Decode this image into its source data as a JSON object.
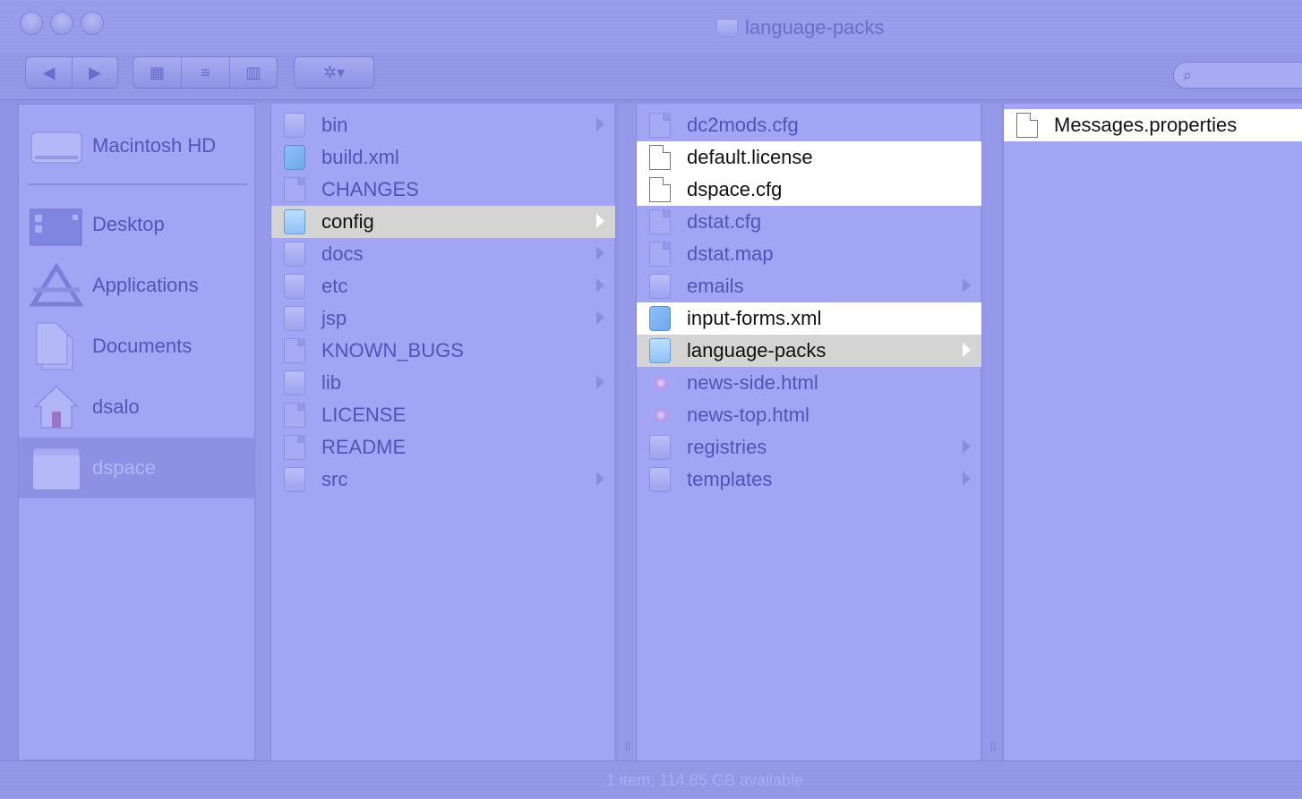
{
  "window": {
    "title": "language-packs"
  },
  "toolbar": {
    "back_icon": "◀",
    "forward_icon": "▶",
    "view_icon_grid": "▦",
    "view_icon_list": "≡",
    "view_icon_columns": "▥",
    "action_icon": "✲▾",
    "search_icon": "⌕"
  },
  "sidebar": {
    "items": [
      {
        "label": "Macintosh HD",
        "icon": "hard-drive-icon"
      },
      {
        "label": "Desktop",
        "icon": "desktop-icon"
      },
      {
        "label": "Applications",
        "icon": "applications-icon"
      },
      {
        "label": "Documents",
        "icon": "documents-icon"
      },
      {
        "label": "dsalo",
        "icon": "home-icon"
      },
      {
        "label": "dspace",
        "icon": "folder-icon"
      }
    ]
  },
  "columns": {
    "col1": [
      {
        "label": "bin",
        "kind": "folder"
      },
      {
        "label": "build.xml",
        "kind": "xml"
      },
      {
        "label": "CHANGES",
        "kind": "doc"
      },
      {
        "label": "config",
        "kind": "folder"
      },
      {
        "label": "docs",
        "kind": "folder"
      },
      {
        "label": "etc",
        "kind": "folder"
      },
      {
        "label": "jsp",
        "kind": "folder"
      },
      {
        "label": "KNOWN_BUGS",
        "kind": "doc"
      },
      {
        "label": "lib",
        "kind": "folder"
      },
      {
        "label": "LICENSE",
        "kind": "doc"
      },
      {
        "label": "README",
        "kind": "doc"
      },
      {
        "label": "src",
        "kind": "folder"
      }
    ],
    "col2": [
      {
        "label": "dc2mods.cfg",
        "kind": "doc"
      },
      {
        "label": "default.license",
        "kind": "doc"
      },
      {
        "label": "dspace.cfg",
        "kind": "doc"
      },
      {
        "label": "dstat.cfg",
        "kind": "doc"
      },
      {
        "label": "dstat.map",
        "kind": "doc"
      },
      {
        "label": "emails",
        "kind": "folder"
      },
      {
        "label": "input-forms.xml",
        "kind": "xml"
      },
      {
        "label": "language-packs",
        "kind": "folder"
      },
      {
        "label": "news-side.html",
        "kind": "html"
      },
      {
        "label": "news-top.html",
        "kind": "html"
      },
      {
        "label": "registries",
        "kind": "folder"
      },
      {
        "label": "templates",
        "kind": "folder"
      }
    ],
    "col3": [
      {
        "label": "Messages.properties",
        "kind": "doc"
      }
    ]
  },
  "status": {
    "text": "1 item, 114.85 GB available"
  }
}
